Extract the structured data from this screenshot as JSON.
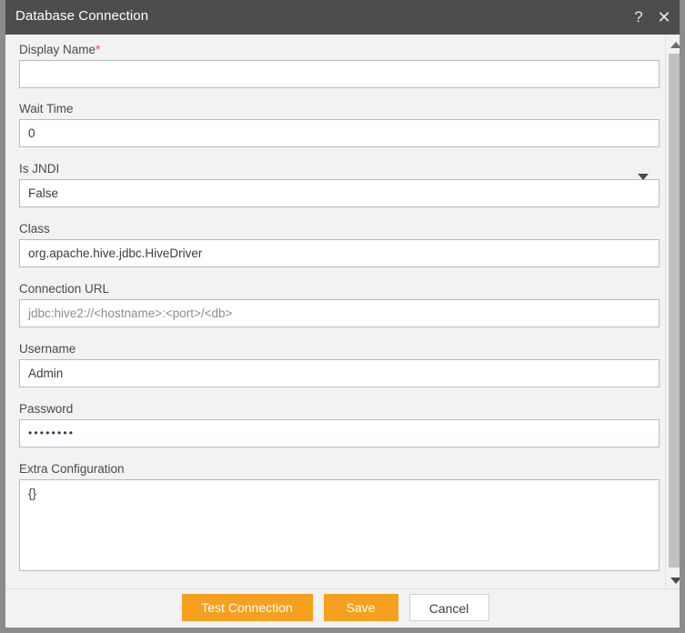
{
  "window": {
    "title": "Database Connection",
    "help_icon": "question-mark-icon",
    "close_icon": "close-icon",
    "accent_color": "#f5a01e",
    "titlebar_color": "#4d4d4d",
    "required_marker": "*"
  },
  "form": {
    "fields": [
      {
        "label": "Display Name",
        "required": true,
        "value": "",
        "type": "text"
      },
      {
        "label": "Wait Time",
        "required": false,
        "value": "0",
        "type": "text"
      },
      {
        "label": "Is JNDI",
        "required": false,
        "value": "False",
        "type": "select"
      },
      {
        "label": "Class",
        "required": false,
        "value": "org.apache.hive.jdbc.HiveDriver",
        "type": "text"
      },
      {
        "label": "Connection URL",
        "required": false,
        "value": "jdbc:hive2://<hostname>:<port>/<db>",
        "type": "text",
        "placeholder_style": true
      },
      {
        "label": "Username",
        "required": false,
        "value": "Admin",
        "type": "text"
      },
      {
        "label": "Password",
        "required": false,
        "value": "••••••••",
        "type": "password"
      },
      {
        "label": "Extra Configuration",
        "required": false,
        "value": "{}",
        "type": "textarea"
      }
    ]
  },
  "footer": {
    "test_label": "Test Connection",
    "save_label": "Save",
    "cancel_label": "Cancel"
  },
  "scrollbar": {
    "up_icon": "chevron-up-icon",
    "down_icon": "chevron-down-icon"
  }
}
